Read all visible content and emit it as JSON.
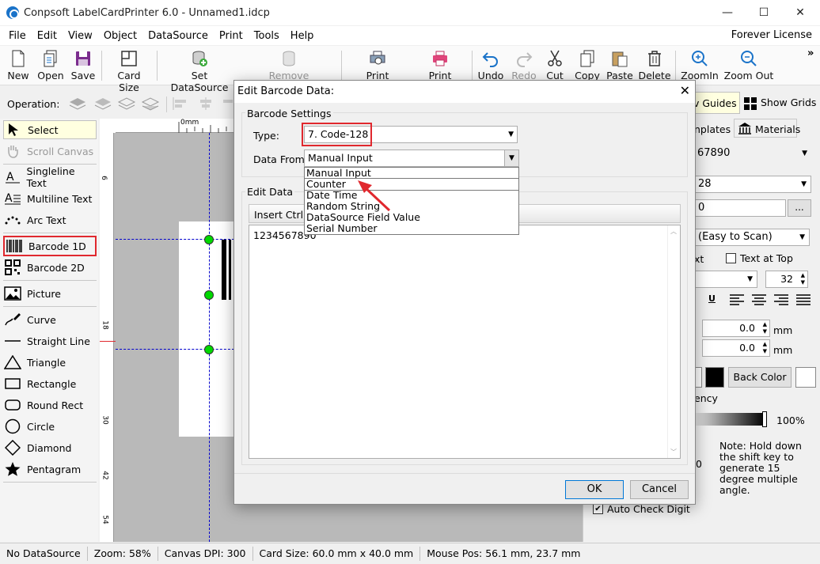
{
  "window": {
    "title": "Conpsoft LabelCardPrinter 6.0 - Unnamed1.idcp",
    "minimize": "—",
    "maximize": "☐",
    "close": "✕"
  },
  "menu": {
    "items": [
      "File",
      "Edit",
      "View",
      "Object",
      "DataSource",
      "Print",
      "Tools",
      "Help"
    ],
    "license": "Forever License"
  },
  "toolbar": {
    "new": "New",
    "open": "Open",
    "save": "Save",
    "card_size": "Card Size",
    "set_datasource": "Set DataSource",
    "remove_datasource": "Remove DataSource",
    "print_preview": "Print Preview",
    "print_direct": "Print Direct",
    "undo": "Undo",
    "redo": "Redo",
    "cut": "Cut",
    "copy": "Copy",
    "paste": "Paste",
    "delete": "Delete",
    "zoom_in": "ZoomIn",
    "zoom_out": "Zoom Out",
    "overflow": "»"
  },
  "operation": {
    "label": "Operation:",
    "show_guides": "Show Guides",
    "show_guides_visible": "v Guides",
    "show_grids": "Show Grids"
  },
  "tools": {
    "select": "Select",
    "scroll_canvas": "Scroll Canvas",
    "singleline_text": "Singleline Text",
    "multiline_text": "Multiline Text",
    "arc_text": "Arc Text",
    "barcode_1d": "Barcode 1D",
    "barcode_2d": "Barcode 2D",
    "picture": "Picture",
    "curve": "Curve",
    "straight_line": "Straight Line",
    "triangle": "Triangle",
    "rectangle": "Rectangle",
    "round_rect": "Round Rect",
    "circle": "Circle",
    "diamond": "Diamond",
    "pentagram": "Pentagram"
  },
  "ruler": {
    "top_zero": "0mm",
    "left_marks": [
      "6",
      "18",
      "30",
      "42",
      "54"
    ]
  },
  "right_panel": {
    "tab_templates": "nplates",
    "tab_materials": "Materials",
    "data_value": "67890",
    "type_value": "28",
    "row_value": "0",
    "ellipsis": "...",
    "easy_scan": "(Easy to Scan)",
    "text_label": "xt",
    "text_at_top": "Text at Top",
    "font_size": "32",
    "underline": "U",
    "offset_x": "0.0",
    "offset_y": "0.0",
    "unit_mm": "mm",
    "back_color": "Back Color",
    "transparency_label": "ency",
    "transparency_value": "100%",
    "angle_digit": "0",
    "note": "Note: Hold down the shift key to generate 15 degree multiple angle.",
    "auto_check_digit": "Auto Check Digit"
  },
  "status": {
    "datasource": "No DataSource",
    "zoom": "Zoom: 58%",
    "dpi": "Canvas DPI: 300",
    "card_size": "Card Size: 60.0 mm x 40.0 mm",
    "mouse_pos": "Mouse Pos: 56.1 mm, 23.7 mm"
  },
  "dialog": {
    "title": "Edit Barcode Data:",
    "close": "✕",
    "barcode_settings": "Barcode Settings",
    "type_label": "Type:",
    "type_value": "7.  Code-128",
    "data_from_label": "Data From:",
    "data_from_value": "Manual Input",
    "dropdown_options": [
      "Manual Input",
      "Counter",
      "Date Time",
      "Random String",
      "DataSource Field Value",
      "Serial Number"
    ],
    "edit_data": "Edit Data",
    "insert_ctrl": "Insert Ctrl",
    "text_value": "1234567890",
    "ok": "OK",
    "cancel": "Cancel"
  },
  "colors": {
    "highlight_red": "#e0282e",
    "handle_green": "#00d800",
    "guide_blue": "#0000cc"
  }
}
